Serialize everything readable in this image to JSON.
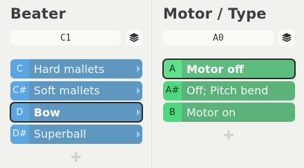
{
  "beater": {
    "title": "Beater",
    "select_value": "C1",
    "items": [
      {
        "key": "C",
        "label": "Hard mallets",
        "selected": false
      },
      {
        "key": "C#",
        "label": "Soft mallets",
        "selected": false
      },
      {
        "key": "D",
        "label": "Bow",
        "selected": true
      },
      {
        "key": "D#",
        "label": "Superball",
        "selected": false
      }
    ]
  },
  "motor": {
    "title": "Motor / Type",
    "select_value": "A0",
    "items": [
      {
        "key": "A",
        "label": "Motor off",
        "selected": true
      },
      {
        "key": "A#",
        "label": "Off; Pitch bend",
        "selected": false
      },
      {
        "key": "B",
        "label": "Motor on",
        "selected": false
      }
    ]
  },
  "icons": {
    "layers": "layers-icon",
    "chevron": "chevron-right-icon",
    "add": "plus-icon"
  },
  "colors": {
    "beater_key": "#5aa6e2",
    "beater_item": "#5e97bf",
    "motor_key": "#4fd97e",
    "motor_item": "#5bb37a"
  }
}
